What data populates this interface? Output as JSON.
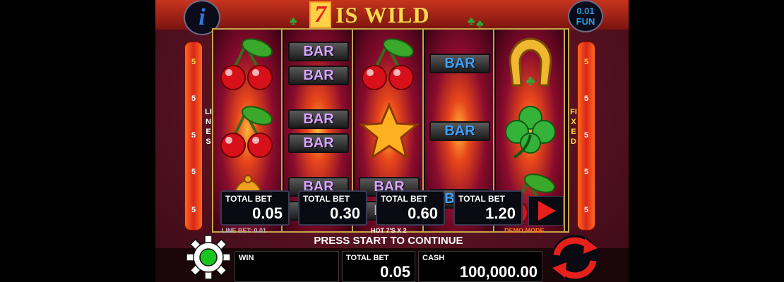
{
  "header": {
    "title_seven": "7",
    "title_text": "IS WILD",
    "info_label": "i",
    "coin_value": "0.01",
    "coin_currency": "FUN"
  },
  "left_lines": {
    "label": "LINES",
    "values": [
      "5",
      "5",
      "5",
      "5",
      "5"
    ]
  },
  "right_lines": {
    "label": "FIXED",
    "values": [
      "5",
      "5",
      "5",
      "5",
      "5"
    ]
  },
  "reels": [
    [
      "cherry",
      "cherry",
      "bell"
    ],
    [
      "double-bar",
      "double-bar",
      "double-bar"
    ],
    [
      "cherry",
      "star",
      "double-bar"
    ],
    [
      "bar",
      "bar",
      "bar"
    ],
    [
      "horseshoe",
      "clover",
      "cherry"
    ]
  ],
  "bar_label": "BAR",
  "bet_buttons": [
    {
      "label": "TOTAL BET",
      "value": "0.05"
    },
    {
      "label": "TOTAL BET",
      "value": "0.30"
    },
    {
      "label": "TOTAL BET",
      "value": "0.60"
    },
    {
      "label": "TOTAL BET",
      "value": "1.20"
    }
  ],
  "status": {
    "line_bet": "LINE BET: 0.01",
    "feature": "HOT 7'S X 2",
    "mode": "DEMO MODE",
    "prompt": "PRESS START TO CONTINUE"
  },
  "bottom": {
    "win_label": "WIN",
    "win_value": "",
    "total_bet_label": "TOTAL BET",
    "total_bet_value": "0.05",
    "cash_label": "CASH",
    "cash_value": "100,000.00"
  },
  "colors": {
    "accent_red": "#e8201c",
    "gold": "#ffd84a",
    "frame_gold": "#c7a34a",
    "blue": "#2b7be0",
    "green": "#19c41e",
    "demo_orange": "#ff7a1a"
  }
}
